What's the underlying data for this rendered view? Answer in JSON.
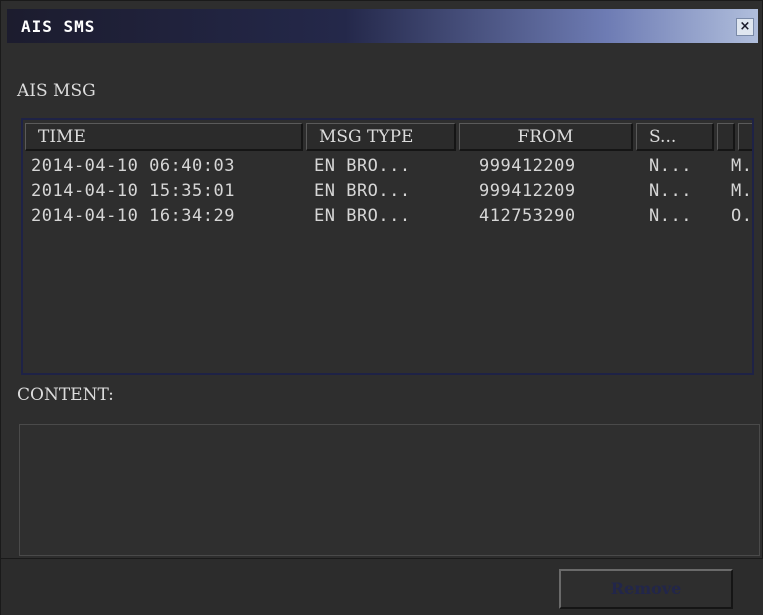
{
  "window": {
    "title": "AIS SMS",
    "close_glyph": "×"
  },
  "section": {
    "ais_label": "AIS MSG",
    "content_label": "CONTENT:"
  },
  "table": {
    "columns": [
      "TIME",
      "MSG TYPE",
      "FROM",
      "S...",
      "",
      ""
    ],
    "rows": [
      {
        "time": "2014-04-10 06:40:03",
        "type": "EN BRO...",
        "from": "999412209",
        "status": "N...",
        "extra": "M."
      },
      {
        "time": "2014-04-10 15:35:01",
        "type": "EN BRO...",
        "from": "999412209",
        "status": "N...",
        "extra": "M."
      },
      {
        "time": "2014-04-10 16:34:29",
        "type": "EN BRO...",
        "from": "412753290",
        "status": "N...",
        "extra": "O."
      }
    ]
  },
  "content_text": "",
  "buttons": {
    "remove_label": "Remove"
  },
  "colors": {
    "background": "#2e2e2e",
    "title_gradient_end": "#b0bedc",
    "text": "#d6d6d6",
    "table_border": "#1e2246",
    "disabled_button_text": "#22264a"
  }
}
